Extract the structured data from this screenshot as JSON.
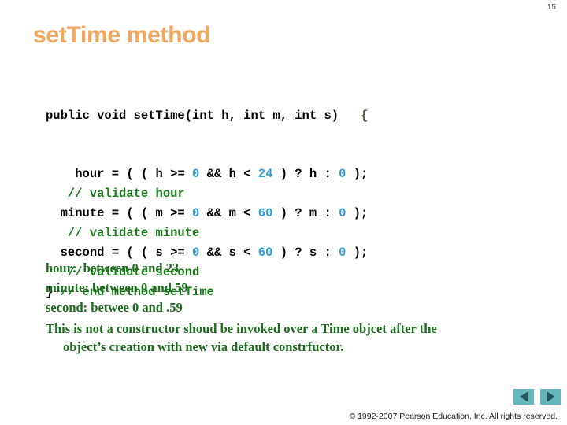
{
  "slide": {
    "page_number": "15",
    "title": "setTime method",
    "title_color": "#EFA860",
    "background": "#ffffff"
  },
  "code": {
    "language": "java",
    "colors": {
      "plain": "#000000",
      "number": "#2E9BD8",
      "comment": "#1A7A1A",
      "brace": "#56563A"
    },
    "signature": {
      "text": "public void setTime(int h, int m, int s)",
      "open_brace": "{"
    },
    "lines": [
      {
        "indent": "    ",
        "parts": [
          {
            "t": "hour = ( ( h >= ",
            "c": "plain"
          },
          {
            "t": "0",
            "c": "number"
          },
          {
            "t": " && h < ",
            "c": "plain"
          },
          {
            "t": "24",
            "c": "number"
          },
          {
            "t": " ) ? h : ",
            "c": "plain"
          },
          {
            "t": "0",
            "c": "number"
          },
          {
            "t": " );",
            "c": "plain"
          }
        ]
      },
      {
        "indent": "   ",
        "parts": [
          {
            "t": "// validate hour",
            "c": "comment"
          }
        ]
      },
      {
        "indent": "  ",
        "parts": [
          {
            "t": "minute = ( ( m >= ",
            "c": "plain"
          },
          {
            "t": "0",
            "c": "number"
          },
          {
            "t": " && m < ",
            "c": "plain"
          },
          {
            "t": "60",
            "c": "number"
          },
          {
            "t": " ) ? m : ",
            "c": "plain"
          },
          {
            "t": "0",
            "c": "number"
          },
          {
            "t": " );",
            "c": "plain"
          }
        ]
      },
      {
        "indent": "   ",
        "parts": [
          {
            "t": "// validate minute",
            "c": "comment"
          }
        ]
      },
      {
        "indent": "  ",
        "parts": [
          {
            "t": "second = ( ( s >= ",
            "c": "plain"
          },
          {
            "t": "0",
            "c": "number"
          },
          {
            "t": " && s < ",
            "c": "plain"
          },
          {
            "t": "60",
            "c": "number"
          },
          {
            "t": " ) ? s : ",
            "c": "plain"
          },
          {
            "t": "0",
            "c": "number"
          },
          {
            "t": " );",
            "c": "plain"
          }
        ]
      },
      {
        "indent": "   ",
        "parts": [
          {
            "t": "// validate second",
            "c": "comment"
          }
        ]
      },
      {
        "indent": "",
        "parts": [
          {
            "t": "} ",
            "c": "plain"
          },
          {
            "t": "// end method setTime",
            "c": "comment"
          }
        ]
      }
    ]
  },
  "notes": {
    "color": "#1A6B1A",
    "lines": [
      "hour:  between 0 and 23",
      "minute: between 0 and 59",
      "second: betwee 0 and .59"
    ],
    "paragraph": {
      "line1": "This is not a constructor shoud be invoked over a Time objcet after the",
      "line2": "object’s creation with new via default constrfuctor."
    }
  },
  "nav": {
    "prev_label": "Previous slide",
    "next_label": "Next slide",
    "button_color": "#63B5BE",
    "arrow_color": "#25555C"
  },
  "footer": {
    "copyright": "© 1992-2007 Pearson Education, Inc.  All rights reserved."
  }
}
